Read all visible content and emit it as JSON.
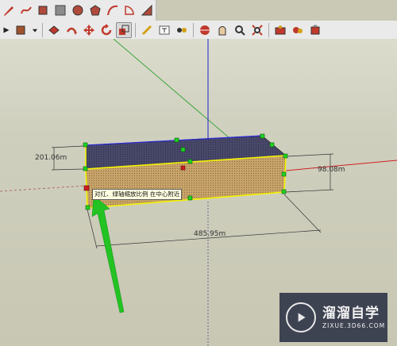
{
  "toolbar_top": {
    "icons": [
      "pencil-icon",
      "freehand-icon",
      "rectangle-icon",
      "shape-icon",
      "circle-icon",
      "polygon-icon",
      "arc-icon",
      "pie-icon",
      "sweep-icon"
    ]
  },
  "toolbar_main": {
    "icons": [
      "select-arrow-icon",
      "eraser-icon",
      "paint-bucket-icon",
      "push-pull-icon",
      "rotate-icon",
      "move-icon",
      "follow-me-icon",
      "scale-icon",
      "tape-measure-icon",
      "text-icon",
      "dimension-icon",
      "orbit-icon",
      "pan-icon",
      "zoom-icon",
      "zoom-extents-icon",
      "component-icon",
      "warehouse-icon",
      "extension-icon"
    ],
    "active": "scale-icon"
  },
  "model": {
    "dimension_width": "201.06m",
    "dimension_height": "98.08m",
    "dimension_length": "485.95m",
    "tooltip": "对红、绿轴缩放比例 在中心附近"
  },
  "colors": {
    "box_front": "#c8a46a",
    "box_top": "#48486a",
    "selection": "#f4f400",
    "grip": "#1fd41f",
    "arrow": "#22c322"
  },
  "watermark": {
    "title": "溜溜自学",
    "subtitle": "ZIXUE.3D66.COM"
  }
}
